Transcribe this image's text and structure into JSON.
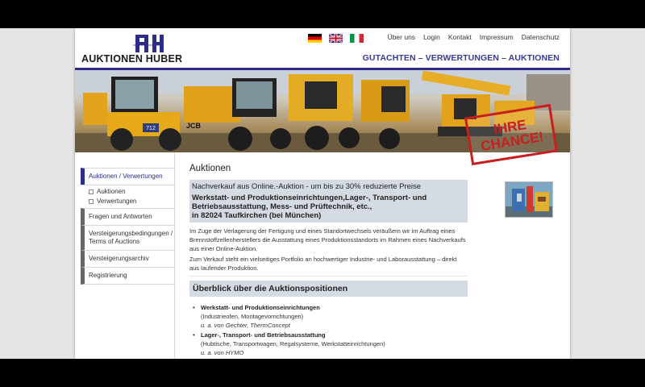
{
  "header": {
    "logo_text": "AUKTIONEN HUBER",
    "logo_mark": "AH",
    "tagline": "GUTACHTEN – VERWERTUNGEN – AUKTIONEN",
    "nav": [
      "Über uns",
      "Login",
      "Kontakt",
      "Impressum",
      "Datenschutz"
    ],
    "languages": [
      "de",
      "en",
      "it"
    ]
  },
  "banner": {
    "stamp_line1": "IHRE",
    "stamp_line2": "CHANCE!",
    "machine_labels": [
      "712",
      "JCB"
    ]
  },
  "sidebar": {
    "active": "Auktionen / Verwertungen",
    "sub": [
      "Auktionen",
      "Verwertungen"
    ],
    "items": [
      "Fragen und Antworten",
      "Versteigerungsbedingungen / Terms of Auctions",
      "Versteigerungsarchiv",
      "Registrierung"
    ]
  },
  "main": {
    "title": "Auktionen",
    "promo_lead": "Nachverkauf aus Online.-Auktion - um bis zu 30% reduzierte Preise",
    "promo_head": "Werkstatt- und Produktionseinrichtungen,Lager-, Transport- und Betriebsausstattung, Mess- und Prüftechnik, etc.,",
    "promo_head2": "in 82024 Taufkirchen (bei München)",
    "para1": "Im Zuge der Verlagerung der Fertigung und eines Standortwechsels veräußern wir im Auftrag eines Brennstoffzellenherstellers die Ausstattung eines Produktionsstandorts im Rahmen eines Nachverkaufs aus einer Online-Auktion.",
    "para2": "Zum Verkauf steht ein vielseitiges Portfolio an hochwertiger Industrie- und Laborausstattung – direkt aus laufender Produktion.",
    "section_title": "Überblick über die Auktionspositionen",
    "positions": [
      {
        "title": "Werkstatt- und Produktionseinrichtungen",
        "desc": "(Industrieofen, Montagevorrichtungen)",
        "ex": "u. a. von Gechter, ThermConcept"
      },
      {
        "title": "Lager-, Transport- und Betriebsausstattung",
        "desc": "(Hubtische, Transportwagen, Regalsysteme, Werkstatteinrichtungen)",
        "ex": "u. a. von HYMO"
      }
    ]
  },
  "colors": {
    "brand": "#2c2c8a",
    "promo_bg": "#d5dbe3",
    "stamp": "#c81e1e"
  }
}
